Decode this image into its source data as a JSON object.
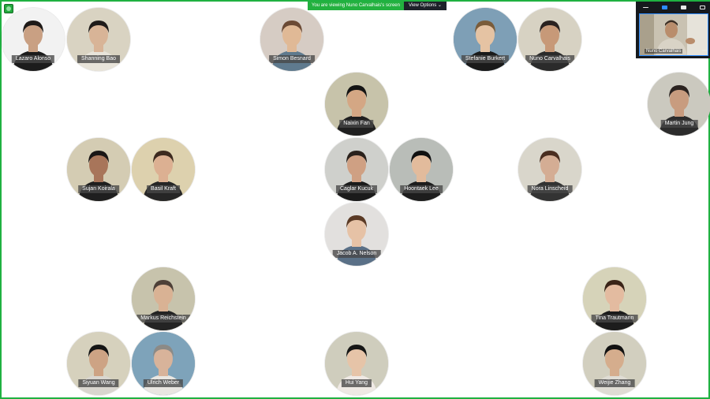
{
  "share_bar": {
    "notice": "You are viewing Nuno Carvalhais's screen",
    "view_options": "View Options"
  },
  "self_view": {
    "name": "Nuno Carvalhais",
    "more": "⋯"
  },
  "participants": [
    {
      "name": "Lazaro Alonso",
      "bg": "#f2f2f2"
    },
    {
      "name": "Shanning Bao",
      "bg": "#d9d3c2"
    },
    {
      "name": "Simon Besnard",
      "bg": "#d6ccc4"
    },
    {
      "name": "Stefanie Burkert",
      "bg": "#7e9fb6"
    },
    {
      "name": "Nuno Carvalhais",
      "bg": "#d7d2c3"
    },
    {
      "name": "Naixin Fan",
      "bg": "#c7c3aa"
    },
    {
      "name": "Martin Jung",
      "bg": "#cbc9bf"
    },
    {
      "name": "Sujan Koirala",
      "bg": "#d4ccb3"
    },
    {
      "name": "Basil Kraft",
      "bg": "#ddd1ae"
    },
    {
      "name": "Caglar Kucuk",
      "bg": "#cfd0cc"
    },
    {
      "name": "Hoontaek Lee",
      "bg": "#b9bdb8"
    },
    {
      "name": "Nora Linscheid",
      "bg": "#d9d6cb"
    },
    {
      "name": "Jacob A. Nelson",
      "bg": "#e2e0de"
    },
    {
      "name": "Markus Reichstein",
      "bg": "#c7c3ac"
    },
    {
      "name": "Tina Trautmann",
      "bg": "#d6d3b9"
    },
    {
      "name": "Siyuan Wang",
      "bg": "#d6d1bd"
    },
    {
      "name": "Ulrich Weber",
      "bg": "#7ea3ba"
    },
    {
      "name": "Hui Yang",
      "bg": "#cfcdbd"
    },
    {
      "name": "Weijie Zhang",
      "bg": "#d2cfbf"
    }
  ]
}
